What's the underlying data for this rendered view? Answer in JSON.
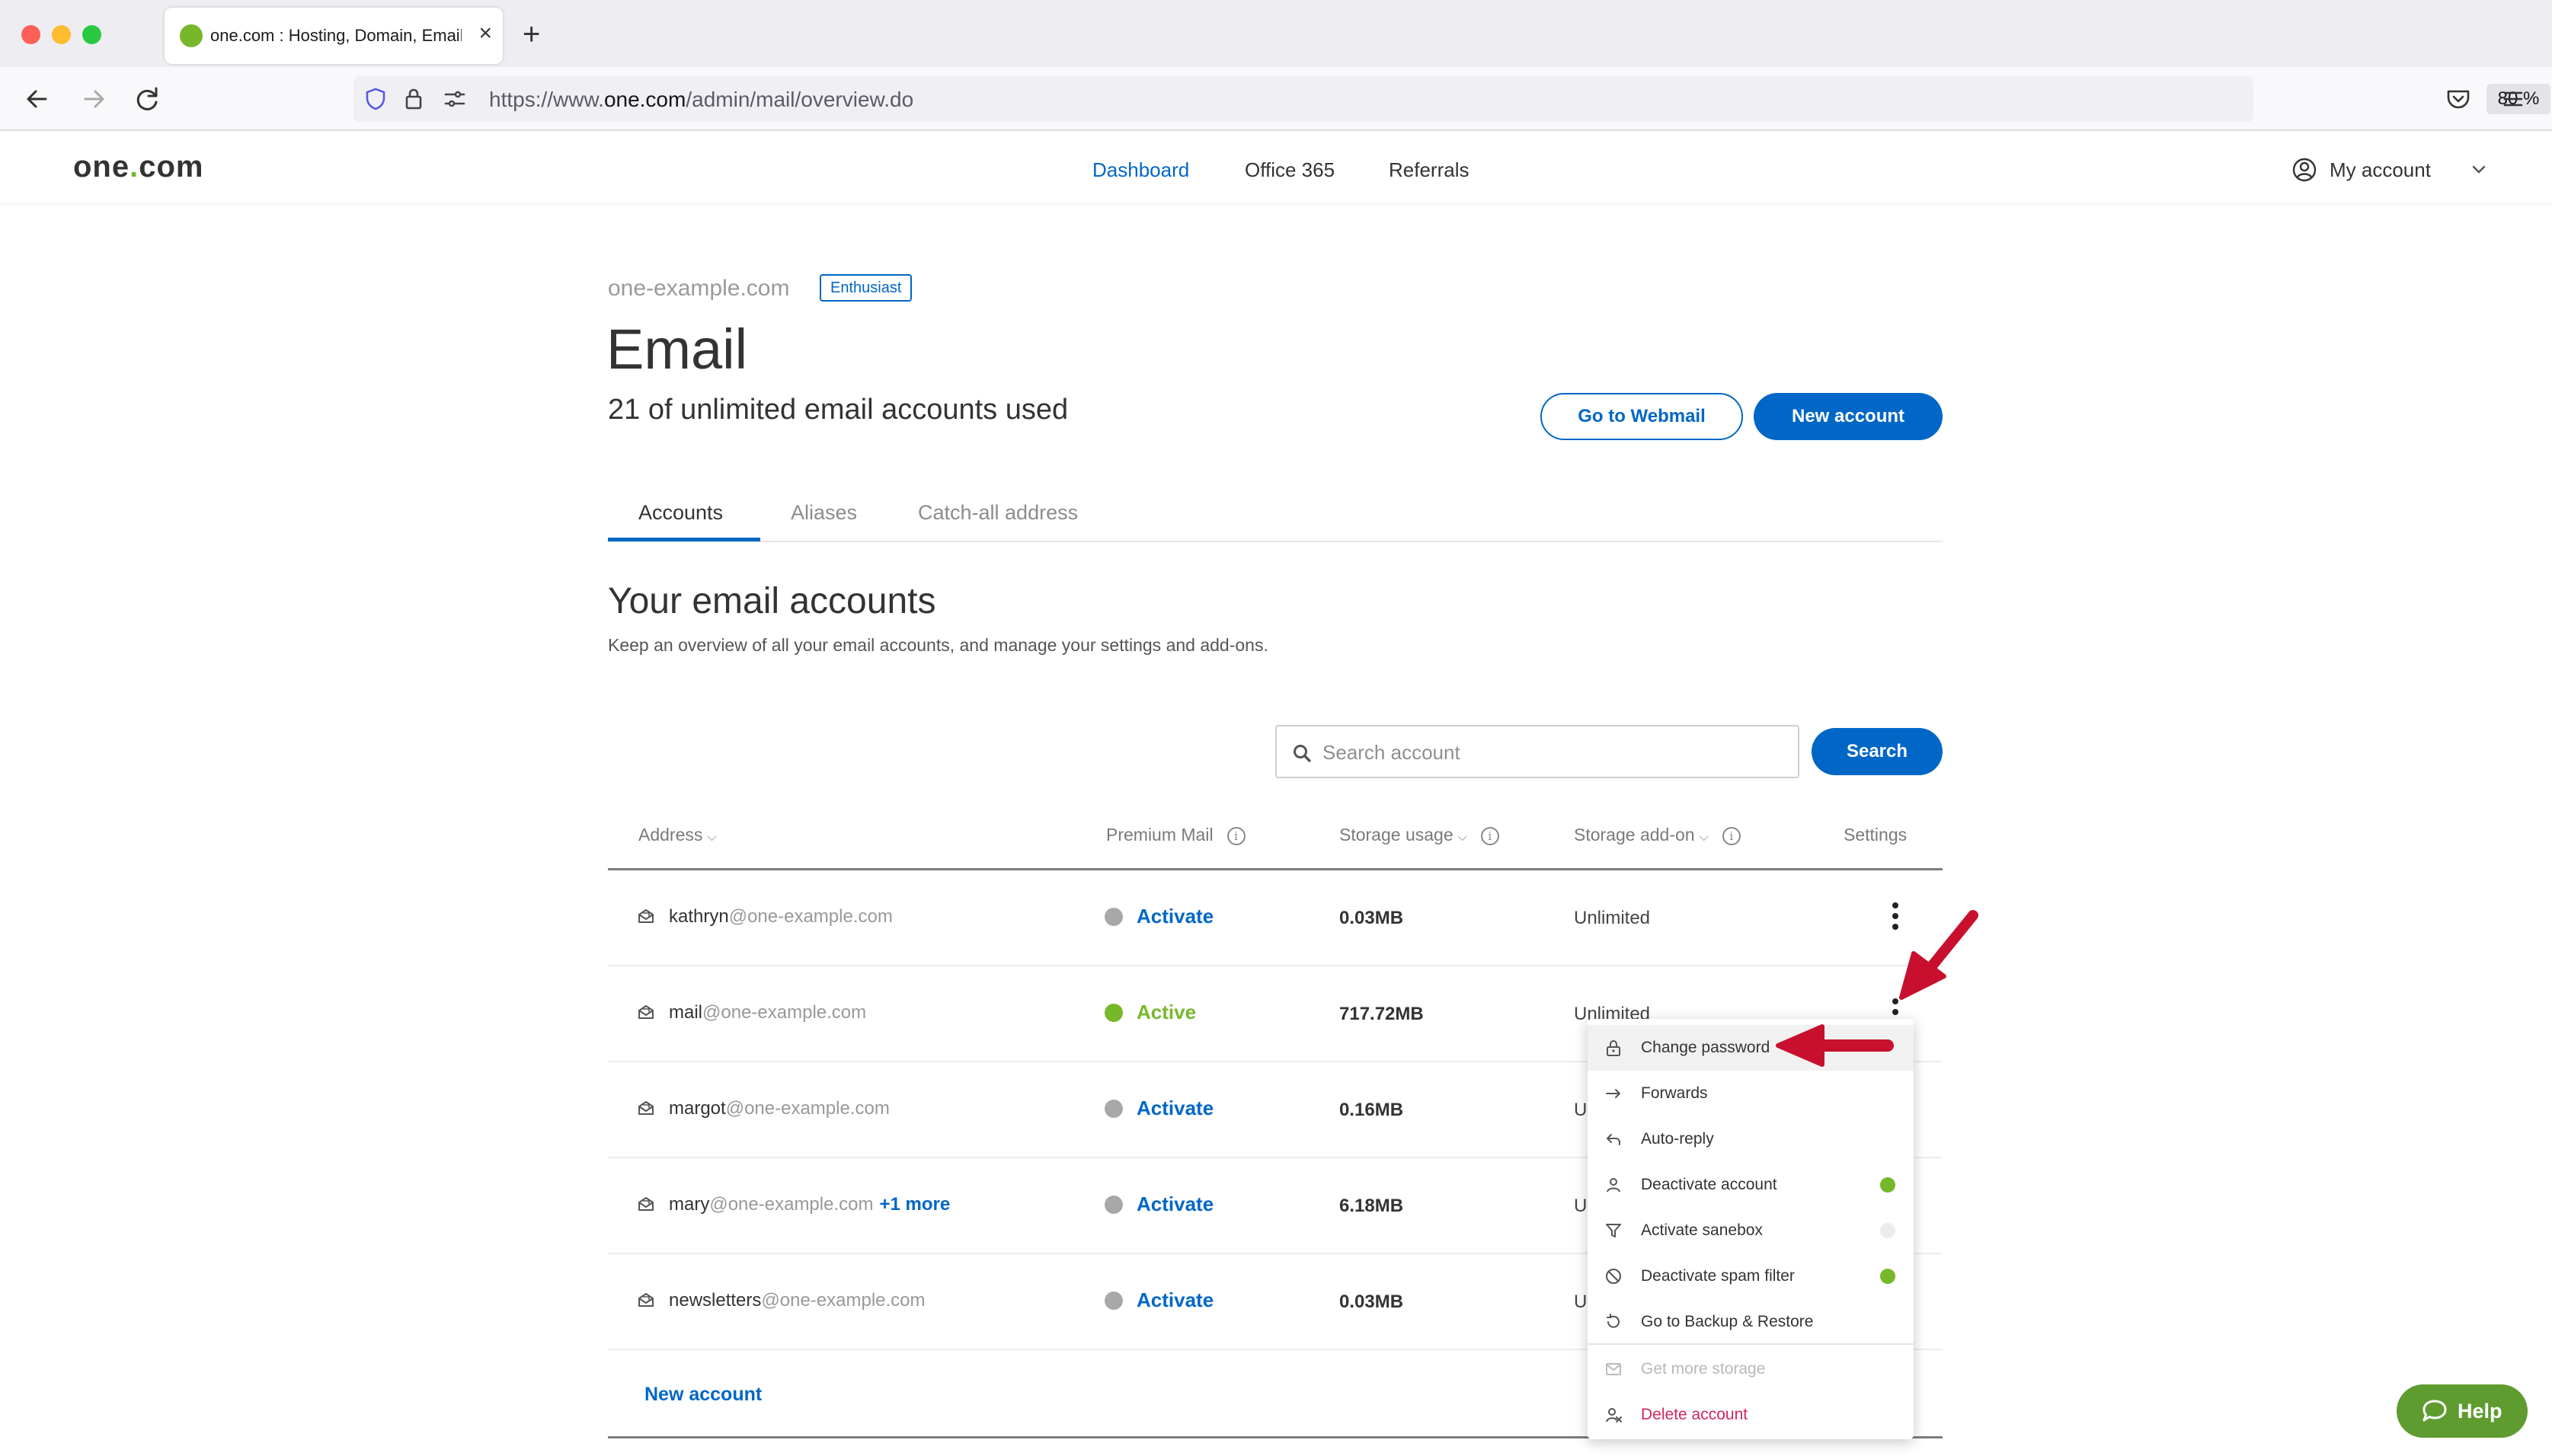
{
  "browser": {
    "tab_title": "one.com : Hosting, Domain, Email",
    "url_host_prefix": "https://www.",
    "url_host": "one.com",
    "url_path": "/admin/mail/overview.do",
    "zoom": "80 %"
  },
  "header": {
    "logo_left": "one",
    "logo_dot": ".",
    "logo_right": "com",
    "nav": [
      "Dashboard",
      "Office 365",
      "Referrals"
    ],
    "my_account": "My account"
  },
  "page": {
    "domain": "one-example.com",
    "plan": "Enthusiast",
    "title": "Email",
    "usage": "21 of unlimited email accounts used",
    "webmail_button": "Go to Webmail",
    "new_account_button": "New account",
    "tabs": [
      "Accounts",
      "Aliases",
      "Catch-all address"
    ],
    "section_title": "Your email accounts",
    "section_subtitle": "Keep an overview of all your email accounts, and manage your settings and add-ons.",
    "search_placeholder": "Search account",
    "search_button": "Search",
    "new_account_link": "New account"
  },
  "table": {
    "columns": [
      "Address",
      "Premium Mail",
      "Storage usage",
      "Storage add-on",
      "Settings"
    ],
    "rows": [
      {
        "user": "kathryn",
        "domain": "@one-example.com",
        "more": "",
        "status": "Activate",
        "storage": "0.03MB",
        "addon": "Unlimited"
      },
      {
        "user": "mail",
        "domain": "@one-example.com",
        "more": "",
        "status": "Active",
        "storage": "717.72MB",
        "addon": "Unlimited"
      },
      {
        "user": "margot",
        "domain": "@one-example.com",
        "more": "",
        "status": "Activate",
        "storage": "0.16MB",
        "addon": "U"
      },
      {
        "user": "mary",
        "domain": "@one-example.com",
        "more": "+1 more",
        "status": "Activate",
        "storage": "6.18MB",
        "addon": "U"
      },
      {
        "user": "newsletters",
        "domain": "@one-example.com",
        "more": "",
        "status": "Activate",
        "storage": "0.03MB",
        "addon": "U"
      }
    ]
  },
  "menu": {
    "items": [
      {
        "label": "Change password",
        "icon": "lock-icon"
      },
      {
        "label": "Forwards",
        "icon": "arrow-right-icon"
      },
      {
        "label": "Auto-reply",
        "icon": "reply-icon"
      },
      {
        "label": "Deactivate account",
        "icon": "user-icon",
        "toggle": "on"
      },
      {
        "label": "Activate sanebox",
        "icon": "filter-icon",
        "toggle": "off"
      },
      {
        "label": "Deactivate spam filter",
        "icon": "block-icon",
        "toggle": "on"
      },
      {
        "label": "Go to Backup & Restore",
        "icon": "restore-icon"
      },
      {
        "label": "Get more storage",
        "icon": "mail-icon",
        "disabled": true
      },
      {
        "label": "Delete account",
        "icon": "delete-user-icon",
        "danger": true
      }
    ]
  },
  "help": {
    "label": "Help"
  },
  "colors": {
    "brand_blue": "#0067c6",
    "brand_green": "#76b82a",
    "arrow_red": "#c8102e",
    "danger": "#d2265a"
  }
}
